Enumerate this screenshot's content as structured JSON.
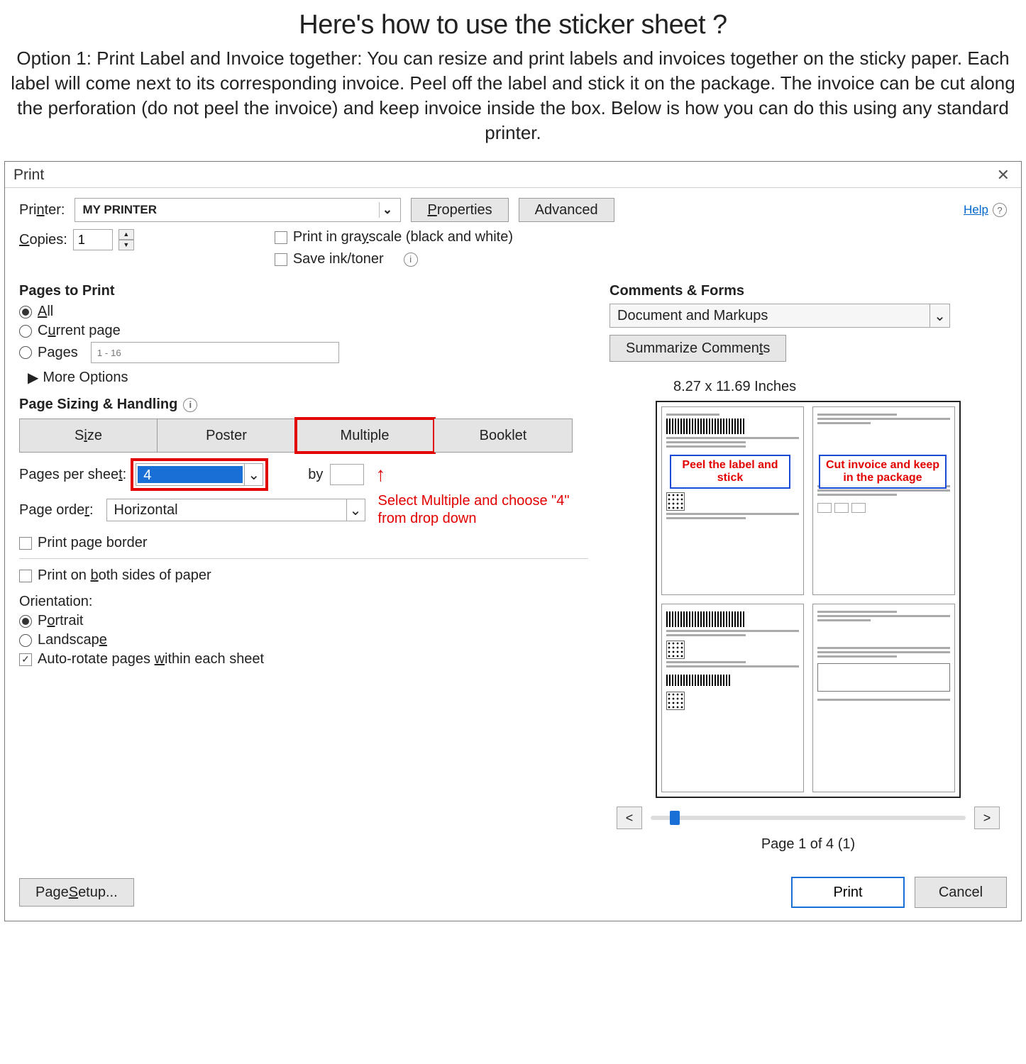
{
  "article": {
    "title": "Here's how to use the sticker sheet ?",
    "option_label": "Option 1:",
    "paragraph": " Print Label and Invoice together: You can resize and print labels and invoices together on the sticky paper. Each label will come next to its corresponding invoice. Peel off the label and stick it on the package. The invoice can be cut along the perforation (do not peel the invoice) and keep invoice inside the box. Below is how you can do this using any standard printer."
  },
  "dialog": {
    "title": "Print",
    "help_label": "Help",
    "printer_label": "Printer:",
    "printer_value": "MY PRINTER",
    "properties_btn": "Properties",
    "advanced_btn": "Advanced",
    "copies_label": "Copies:",
    "copies_value": "1",
    "grayscale_label": "Print in grayscale (black and white)",
    "saveink_label": "Save ink/toner",
    "pages_to_print": "Pages to Print",
    "all_label": "All",
    "current_label": "Current page",
    "pages_label": "Pages",
    "pages_placeholder": "1 - 16",
    "more_options": "More Options",
    "sizing_head": "Page Sizing & Handling",
    "seg": {
      "size": "Size",
      "poster": "Poster",
      "multiple": "Multiple",
      "booklet": "Booklet"
    },
    "pps_label": "Pages per sheet",
    "pps_value": "4",
    "by_label": "by",
    "callout": "Select Multiple and choose \"4\" from drop down",
    "order_label": "Page order:",
    "order_value": "Horizontal",
    "border_label": "Print page border",
    "bothsides_label": "Print on both sides of paper",
    "orientation_head": "Orientation:",
    "portrait": "Portrait",
    "landscape": "Landscape",
    "autorotate": "Auto-rotate pages within each sheet",
    "comments_head": "Comments & Forms",
    "comments_value": "Document and Markups",
    "summarize_btn": "Summarize Comments",
    "paper_dims": "8.27 x 11.69 Inches",
    "anno_left": "Peel the label and stick",
    "anno_right": "Cut invoice and keep in the package",
    "page_counter": "Page 1 of 4 (1)",
    "page_setup": "Page Setup...",
    "print_btn": "Print",
    "cancel_btn": "Cancel",
    "nav_prev": "<",
    "nav_next": ">"
  }
}
